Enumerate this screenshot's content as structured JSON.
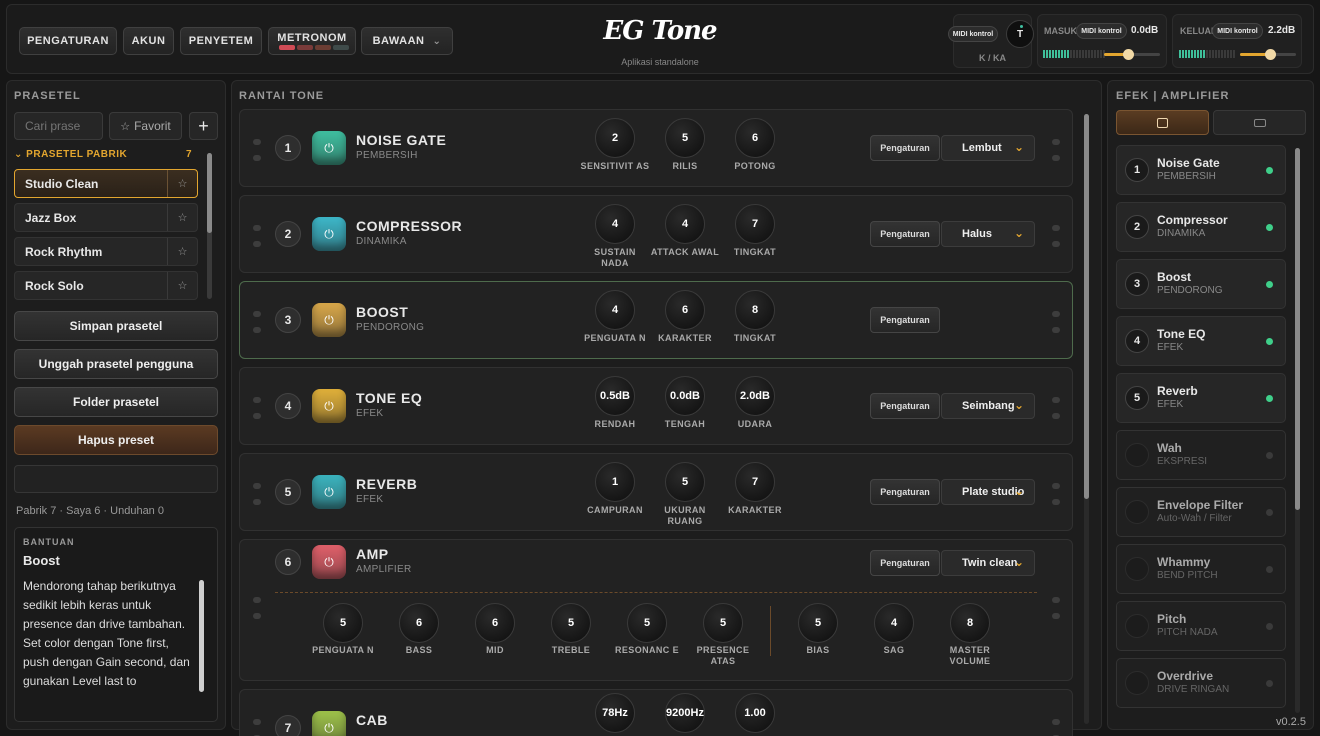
{
  "header": {
    "settings": "PENGATURAN",
    "account": "AKUN",
    "tuner": "PENYETEM",
    "metronome": "METRONOM",
    "default": "BAWAAN",
    "logo": "EG Tone",
    "subtitle": "Aplikasi standalone",
    "midi": "MIDI kontrol",
    "knob_label": "T",
    "lr": "K / KA",
    "input_label": "MASUK",
    "input_value": "0.0dB",
    "output_label": "KELUAI",
    "output_value": "2.2dB"
  },
  "left": {
    "title": "PRASETEL",
    "search_placeholder": "Cari prase",
    "favorite": "Favorit",
    "add": "+",
    "factory_label": "PRASETEL PABRIK",
    "factory_count": "7",
    "presets": [
      {
        "name": "Studio Clean"
      },
      {
        "name": "Jazz Box"
      },
      {
        "name": "Rock Rhythm"
      },
      {
        "name": "Rock Solo"
      }
    ],
    "save": "Simpan prasetel",
    "upload": "Unggah prasetel pengguna",
    "folder": "Folder prasetel",
    "delete": "Hapus preset",
    "stats": "Pabrik 7 · Saya 6 · Unduhan 0",
    "help": {
      "title": "BANTUAN",
      "heading": "Boost",
      "text": "Mendorong tahap berikutnya sedikit lebih keras untuk presence dan drive tambahan.\nSet color dengan Tone first, push dengan Gain second, dan gunakan Level last to"
    }
  },
  "chain": {
    "title": "RANTAI TONE",
    "modules": [
      {
        "n": "1",
        "title": "NOISE GATE",
        "sub": "PEMBERSIH",
        "color": "#3fbfa0",
        "setting": "Pengaturan",
        "select": "Lembut",
        "knobs": [
          {
            "v": "2",
            "l": "SENSITIVIT AS"
          },
          {
            "v": "5",
            "l": "RILIS"
          },
          {
            "v": "6",
            "l": "POTONG"
          }
        ]
      },
      {
        "n": "2",
        "title": "COMPRESSOR",
        "sub": "DINAMIKA",
        "color": "#3db7c9",
        "setting": "Pengaturan",
        "select": "Halus",
        "knobs": [
          {
            "v": "4",
            "l": "SUSTAIN NADA"
          },
          {
            "v": "4",
            "l": "ATTACK AWAL"
          },
          {
            "v": "7",
            "l": "TINGKAT"
          }
        ]
      },
      {
        "n": "3",
        "title": "BOOST",
        "sub": "PENDORONG",
        "color": "#d9a84a",
        "setting": "Pengaturan",
        "select": "",
        "knobs": [
          {
            "v": "4",
            "l": "PENGUATA N"
          },
          {
            "v": "6",
            "l": "KARAKTER"
          },
          {
            "v": "8",
            "l": "TINGKAT"
          }
        ]
      },
      {
        "n": "4",
        "title": "TONE EQ",
        "sub": "EFEK",
        "color": "#e0b03a",
        "setting": "Pengaturan",
        "select": "Seimbang",
        "knobs": [
          {
            "v": "0.5dB",
            "l": "RENDAH"
          },
          {
            "v": "0.0dB",
            "l": "TENGAH"
          },
          {
            "v": "2.0dB",
            "l": "UDARA"
          }
        ]
      },
      {
        "n": "5",
        "title": "REVERB",
        "sub": "EFEK",
        "color": "#3bb4bf",
        "setting": "Pengaturan",
        "select": "Plate studio",
        "knobs": [
          {
            "v": "1",
            "l": "CAMPURAN"
          },
          {
            "v": "5",
            "l": "UKURAN RUANG"
          },
          {
            "v": "7",
            "l": "KARAKTER"
          }
        ]
      },
      {
        "n": "6",
        "title": "AMP",
        "sub": "AMPLIFIER",
        "color": "#e0606a",
        "setting": "Pengaturan",
        "select": "Twin clean",
        "knobs": [
          {
            "v": "5",
            "l": "PENGUATA N"
          },
          {
            "v": "6",
            "l": "BASS"
          },
          {
            "v": "6",
            "l": "MID"
          },
          {
            "v": "5",
            "l": "TREBLE"
          },
          {
            "v": "5",
            "l": "RESONANC E"
          },
          {
            "v": "5",
            "l": "PRESENCE ATAS"
          },
          {
            "v": "5",
            "l": "BIAS"
          },
          {
            "v": "4",
            "l": "SAG"
          },
          {
            "v": "8",
            "l": "MASTER VOLUME"
          }
        ]
      },
      {
        "n": "7",
        "title": "CAB",
        "sub": "",
        "color": "#9ec24a",
        "knobs": [
          {
            "v": "78Hz"
          },
          {
            "v": "9200Hz"
          },
          {
            "v": "1.00"
          }
        ]
      }
    ]
  },
  "right": {
    "title": "EFEK | AMPLIFIER",
    "items": [
      {
        "n": "1",
        "t": "Noise Gate",
        "s": "PEMBERSIH",
        "on": true
      },
      {
        "n": "2",
        "t": "Compressor",
        "s": "DINAMIKA",
        "on": true
      },
      {
        "n": "3",
        "t": "Boost",
        "s": "PENDORONG",
        "on": true
      },
      {
        "n": "4",
        "t": "Tone EQ",
        "s": "EFEK",
        "on": true
      },
      {
        "n": "5",
        "t": "Reverb",
        "s": "EFEK",
        "on": true
      },
      {
        "n": "",
        "t": "Wah",
        "s": "EKSPRESI",
        "on": false
      },
      {
        "n": "",
        "t": "Envelope Filter",
        "s": "Auto-Wah / Filter",
        "on": false
      },
      {
        "n": "",
        "t": "Whammy",
        "s": "BEND PITCH",
        "on": false
      },
      {
        "n": "",
        "t": "Pitch",
        "s": "PITCH NADA",
        "on": false
      },
      {
        "n": "",
        "t": "Overdrive",
        "s": "DRIVE RINGAN",
        "on": false
      }
    ]
  },
  "version": "v0.2.5"
}
